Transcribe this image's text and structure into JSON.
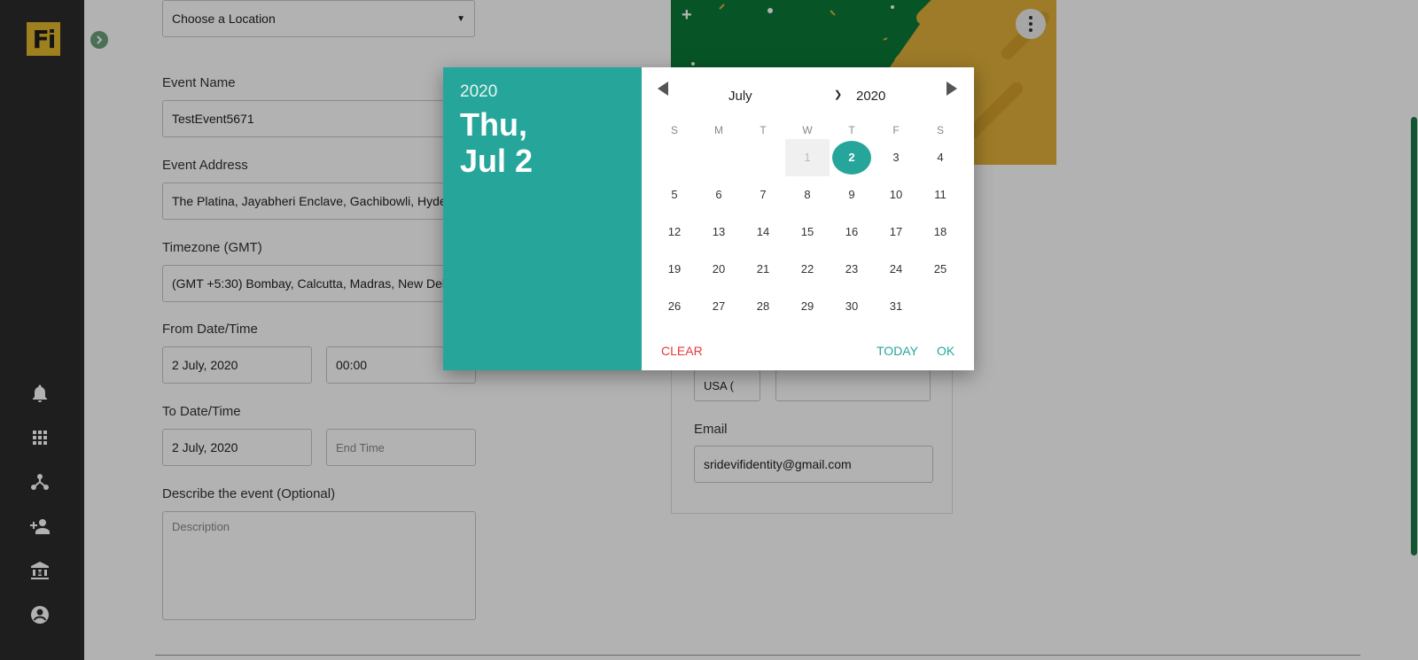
{
  "sidebar": {
    "logo_text": "Fi",
    "icons": [
      "bell-icon",
      "apps-grid-icon",
      "network-icon",
      "add-user-icon",
      "institution-icon",
      "account-icon"
    ]
  },
  "form": {
    "location_select": "Choose a Location",
    "event_name_label": "Event Name",
    "event_name_value": "TestEvent5671",
    "event_address_label": "Event Address",
    "event_address_value": "The Platina, Jayabheri Enclave, Gachibowli, Hyder",
    "timezone_label": "Timezone (GMT)",
    "timezone_value": "(GMT +5:30) Bombay, Calcutta, Madras, New Del",
    "from_label": "From Date/Time",
    "from_date": "2 July, 2020",
    "from_time": "00:00",
    "to_label": "To Date/Time",
    "to_date": "2 July, 2020",
    "to_time_placeholder": "End Time",
    "describe_label": "Describe the event (Optional)",
    "description_placeholder": "Description"
  },
  "right_card": {
    "country_code": "USA (",
    "email_label": "Email",
    "email_value": "sridevifidentity@gmail.com"
  },
  "datepicker": {
    "year": "2020",
    "date_line1": "Thu,",
    "date_line2": "Jul 2",
    "month_select": "July",
    "year_select": "2020",
    "weekdays": [
      "S",
      "M",
      "T",
      "W",
      "T",
      "F",
      "S"
    ],
    "days": [
      "1",
      "2",
      "3",
      "4",
      "5",
      "6",
      "7",
      "8",
      "9",
      "10",
      "11",
      "12",
      "13",
      "14",
      "15",
      "16",
      "17",
      "18",
      "19",
      "20",
      "21",
      "22",
      "23",
      "24",
      "25",
      "26",
      "27",
      "28",
      "29",
      "30",
      "31"
    ],
    "first_weekday_index": 3,
    "selected_day": "2",
    "clear_label": "CLEAR",
    "today_label": "TODAY",
    "ok_label": "OK"
  },
  "colors": {
    "teal": "#26a69a",
    "clear_red": "#e53935",
    "sidebar": "#2b2b2b",
    "logo": "#e3b82c"
  }
}
